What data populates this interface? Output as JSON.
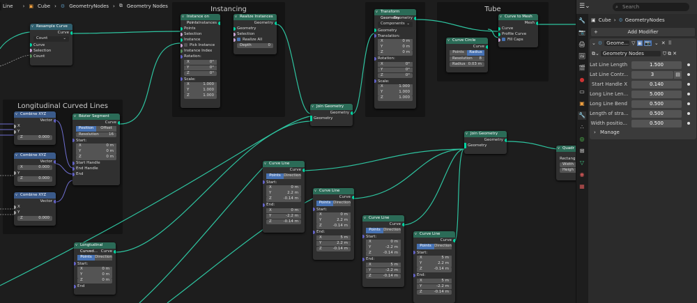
{
  "header": {
    "breadcrumb_1": "Cube",
    "breadcrumb_2": "GeometryNodes",
    "breadcrumb_3": "Geometry Nodes",
    "left_label": "Line"
  },
  "frames": {
    "instancing": "Instancing",
    "tube": "Tube",
    "longitudinal": "Longitudinal  Curved Lines"
  },
  "nodes": {
    "resample": {
      "title": "Resample Curve",
      "out": "Curve",
      "mode": "Count",
      "in1": "Curve",
      "in2": "Selection",
      "in3": "Count"
    },
    "instance_on_points": {
      "title": "Instance on Points",
      "out": "Instances",
      "points": "Points",
      "selection": "Selection",
      "instance": "Instance",
      "pick": "Pick Instance",
      "index": "Instance Index",
      "rotation": "Rotation:",
      "rx": "X",
      "rxv": "0°",
      "ry": "Y",
      "ryv": "0°",
      "rz": "Z",
      "rzv": "0°",
      "scale": "Scale:",
      "sx": "X",
      "sxv": "1.000",
      "sy": "Y",
      "syv": "1.000",
      "sz": "Z",
      "szv": "1.000"
    },
    "realize": {
      "title": "Realize Instances",
      "out": "Geometry",
      "geometry": "Geometry",
      "selection": "Selection",
      "realize_all": "Realize All",
      "depth": "Depth",
      "depth_v": "0"
    },
    "transform": {
      "title": "Transform Geometry",
      "out": "Geometry",
      "mode": "Components",
      "geometry": "Geometry",
      "translation": "Translation:",
      "tx": "X",
      "txv": "0 m",
      "ty": "Y",
      "tyv": "0 m",
      "tz": "Z",
      "tzv": "0 m",
      "rotation": "Rotation:",
      "rx": "X",
      "rxv": "0°",
      "ry": "Y",
      "ryv": "0°",
      "rz": "Z",
      "rzv": "0°",
      "scale": "Scale:",
      "sx": "X",
      "sxv": "1.000",
      "sy": "Y",
      "syv": "1.000",
      "sz": "Z",
      "szv": "1.000"
    },
    "curve_circle": {
      "title": "Curve Circle",
      "out": "Curve",
      "b1": "Points",
      "b2": "Radius",
      "res": "Resolution",
      "res_v": "8",
      "radius": "Radius",
      "radius_v": "0.03 m"
    },
    "curve_to_mesh": {
      "title": "Curve to Mesh",
      "out": "Mesh",
      "curve": "Curve",
      "profile": "Profile Curve",
      "fill": "Fill Caps"
    },
    "join1": {
      "title": "Join Geometry",
      "out": "Geometry",
      "in": "Geometry"
    },
    "join2": {
      "title": "Join Geometry",
      "out": "Geometry",
      "in": "Geometry"
    },
    "combine1": {
      "title": "Combine XYZ",
      "out": "Vector",
      "x": "X",
      "y": "Y",
      "z": "Z",
      "zv": "0.000"
    },
    "combine2": {
      "title": "Combine XYZ",
      "out": "Vector",
      "x": "X",
      "xv": "0.000",
      "y": "Y",
      "z": "Z",
      "zv": "0.000"
    },
    "combine3": {
      "title": "Combine XYZ",
      "out": "Vector",
      "x": "X",
      "y": "Y",
      "z": "Z",
      "zv": "0.000"
    },
    "bezier": {
      "title": "Bézier Segment",
      "out": "Curve",
      "b1": "Position",
      "b2": "Offset",
      "res": "Resolution",
      "res_v": "16",
      "start": "Start:",
      "sx": "X",
      "sxv": "0 m",
      "sy": "Y",
      "syv": "0 m",
      "sz": "Z",
      "szv": "0 m",
      "sh": "Start Handle",
      "eh": "End Handle",
      "end": "End"
    },
    "longcurved": {
      "title": "Longtudinal Curved...",
      "out": "Curve",
      "b1": "Points",
      "b2": "Direction",
      "start": "Start:",
      "x": "X",
      "xv": "0 m",
      "y": "Y",
      "yv": "0 m",
      "z": "Z",
      "zv": "0 m",
      "end": "End"
    },
    "cl1": {
      "title": "Curve Line",
      "out": "Curve",
      "b1": "Points",
      "b2": "Direction",
      "start": "Start:",
      "sx": "X",
      "sxv": "0 m",
      "sy": "Y",
      "syv": "2.2 m",
      "sz": "Z",
      "szv": "-0.14 m",
      "end": "End:",
      "ex": "X",
      "exv": "0 m",
      "ey": "Y",
      "eyv": "-2.2 m",
      "ez": "Z",
      "ezv": "-0.14 m"
    },
    "cl2": {
      "title": "Curve Line",
      "out": "Curve",
      "b1": "Points",
      "b2": "Direction",
      "start": "Start:",
      "sx": "X",
      "sxv": "0 m",
      "sy": "Y",
      "syv": "2.2 m",
      "sz": "Z",
      "szv": "-0.14 m",
      "end": "End:",
      "ex": "X",
      "exv": "5 m",
      "ey": "Y",
      "eyv": "2.2 m",
      "ez": "Z",
      "ezv": "-0.14 m"
    },
    "cl3": {
      "title": "Curve Line",
      "out": "Curve",
      "b1": "Points",
      "b2": "Direction",
      "start": "Start:",
      "sx": "X",
      "sxv": "0 m",
      "sy": "Y",
      "syv": "-2.2 m",
      "sz": "Z",
      "szv": "-0.14 m",
      "end": "End:",
      "ex": "X",
      "exv": "5 m",
      "ey": "Y",
      "eyv": "-2.2 m",
      "ez": "Z",
      "ezv": "-0.14 m"
    },
    "cl4": {
      "title": "Curve Line",
      "out": "Curve",
      "b1": "Points",
      "b2": "Direction",
      "start": "Start:",
      "sx": "X",
      "sxv": "5 m",
      "sy": "Y",
      "syv": "2.2 m",
      "sz": "Z",
      "szv": "-0.14 m",
      "end": "End:",
      "ex": "X",
      "exv": "5 m",
      "ey": "Y",
      "eyv": "-2.2 m",
      "ez": "Z",
      "ezv": "-0.14 m"
    },
    "quad": {
      "title": "Quadr",
      "mode": "Rectang",
      "w": "Width",
      "h": "Heigh"
    }
  },
  "panel": {
    "search_placeholder": "Search",
    "breadcrumb_1": "Cube",
    "breadcrumb_2": "GeometryNodes",
    "add_modifier": "Add Modifier",
    "modifier_name": "Geome...",
    "node_group": "Geometry Nodes",
    "inputs": [
      {
        "label": "Lat Line Length",
        "value": "1.500"
      },
      {
        "label": "Lat Line Contr...",
        "value": "3"
      },
      {
        "label": "Start Handle X",
        "value": "0.140"
      },
      {
        "label": "Long Line Len...",
        "value": "5.000"
      },
      {
        "label": "Long Line Bend",
        "value": "0.500"
      },
      {
        "label": "Length of stra...",
        "value": "0.500"
      },
      {
        "label": "Width positio...",
        "value": "0.500"
      }
    ],
    "manage": "Manage"
  }
}
